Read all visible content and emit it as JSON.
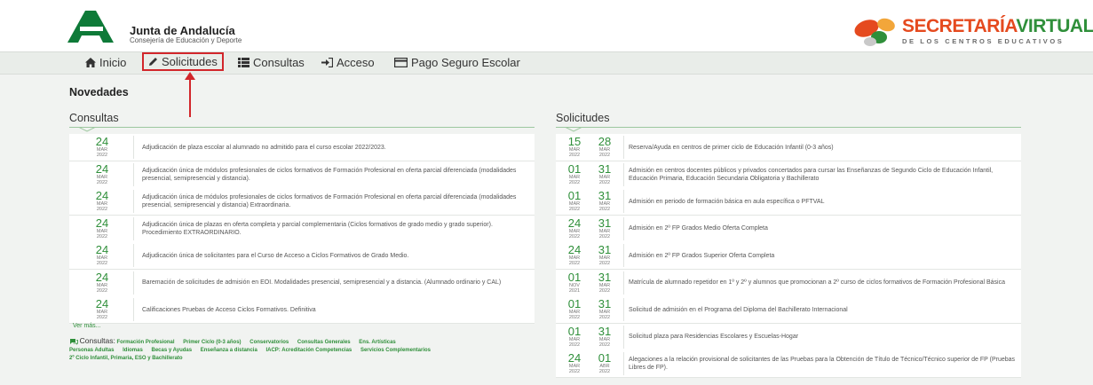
{
  "header": {
    "org_name": "Junta de Andalucía",
    "org_sub": "Consejería de Educación y Deporte",
    "sv_title_a": "SECRETARÍA",
    "sv_title_b": "VIRTUAL",
    "sv_sub": "DE LOS CENTROS EDUCATIVOS"
  },
  "nav": {
    "items": [
      {
        "label": "Inicio",
        "icon": "home-icon"
      },
      {
        "label": "Solicitudes",
        "icon": "pencil-icon"
      },
      {
        "label": "Consultas",
        "icon": "list-icon"
      },
      {
        "label": "Acceso",
        "icon": "sign-in-icon"
      },
      {
        "label": "Pago Seguro Escolar",
        "icon": "credit-card-icon"
      }
    ]
  },
  "novedades_title": "Novedades",
  "consultas": {
    "title": "Consultas",
    "rows": [
      {
        "day": "24",
        "month": "MAR",
        "year": "2022",
        "text": "Adjudicación de plaza escolar al alumnado no admitido para el curso escolar 2022/2023."
      },
      {
        "day": "24",
        "month": "MAR",
        "year": "2022",
        "text": "Adjudicación única de módulos profesionales de ciclos formativos de Formación Profesional en oferta parcial diferenciada (modalidades presencial, semipresencial y distancia)."
      },
      {
        "day": "24",
        "month": "MAR",
        "year": "2022",
        "text": "Adjudicación única de módulos profesionales de ciclos formativos de Formación Profesional en oferta parcial diferenciada (modalidades presencial, semipresencial y distancia) Extraordinaria."
      },
      {
        "day": "24",
        "month": "MAR",
        "year": "2022",
        "text": "Adjudicación única de plazas en oferta completa y parcial complementaria (Ciclos formativos de grado medio y grado superior). Procedimiento EXTRAORDINARIO."
      },
      {
        "day": "24",
        "month": "MAR",
        "year": "2022",
        "text": "Adjudicación única de solicitantes para el Curso de Acceso a Ciclos Formativos de Grado Medio."
      },
      {
        "day": "24",
        "month": "MAR",
        "year": "2022",
        "text": "Baremación de solicitudes de admisión en EOI. Modalidades presencial, semipresencial y a distancia. (Alumnado ordinario y CAL)"
      },
      {
        "day": "24",
        "month": "MAR",
        "year": "2022",
        "text": "Calificaciones Pruebas de Acceso Ciclos Formativos. Definitiva"
      }
    ],
    "ver_mas": "Ver más...",
    "links_lead": "Consultas:",
    "links": [
      "Formación Profesional",
      "Primer Ciclo (0-3 años)",
      "Conservatorios",
      "Consultas Generales",
      "Ens. Artísticas",
      "Personas Adultas",
      "Idiomas",
      "Becas y Ayudas",
      "Enseñanza a distancia",
      "IACP: Acreditación Competencias",
      "Servicios Complementarios",
      "2º Ciclo Infantil, Primaria, ESO y Bachillerato"
    ]
  },
  "solicitudes": {
    "title": "Solicitudes",
    "rows": [
      {
        "d1": "15",
        "m1": "MAR",
        "y1": "2022",
        "d2": "28",
        "m2": "MAR",
        "y2": "2022",
        "text": "Reserva/Ayuda en centros de primer ciclo de Educación Infantil (0-3 años)"
      },
      {
        "d1": "01",
        "m1": "MAR",
        "y1": "2022",
        "d2": "31",
        "m2": "MAR",
        "y2": "2022",
        "text": "Admisión en centros docentes públicos y privados concertados para cursar las Enseñanzas de Segundo Ciclo de Educación Infantil, Educación Primaria, Educación Secundaria Obligatoria y Bachillerato"
      },
      {
        "d1": "01",
        "m1": "MAR",
        "y1": "2022",
        "d2": "31",
        "m2": "MAR",
        "y2": "2022",
        "text": "Admisión en periodo de formación básica en aula específica o PFTVAL"
      },
      {
        "d1": "24",
        "m1": "MAR",
        "y1": "2022",
        "d2": "31",
        "m2": "MAR",
        "y2": "2022",
        "text": "Admisión en 2º FP Grados Medio Oferta Completa"
      },
      {
        "d1": "24",
        "m1": "MAR",
        "y1": "2022",
        "d2": "31",
        "m2": "MAR",
        "y2": "2022",
        "text": "Admisión en 2º FP Grados Superior Oferta Completa"
      },
      {
        "d1": "01",
        "m1": "NOV",
        "y1": "2021",
        "d2": "31",
        "m2": "MAR",
        "y2": "2022",
        "text": "Matrícula de alumnado repetidor en 1º y 2º y alumnos que promocionan a 2º curso de ciclos formativos de Formación Profesional Básica"
      },
      {
        "d1": "01",
        "m1": "MAR",
        "y1": "2022",
        "d2": "31",
        "m2": "MAR",
        "y2": "2022",
        "text": "Solicitud de admisión en el Programa del Diploma del Bachillerato Internacional"
      },
      {
        "d1": "01",
        "m1": "MAR",
        "y1": "2022",
        "d2": "31",
        "m2": "MAR",
        "y2": "2022",
        "text": "Solicitud plaza para Residencias Escolares y Escuelas-Hogar"
      },
      {
        "d1": "24",
        "m1": "MAR",
        "y1": "2022",
        "d2": "01",
        "m2": "ABR",
        "y2": "2022",
        "text": "Alegaciones a la relación provisional de solicitantes de las Pruebas para la Obtención de Título de Técnico/Técnico superior de FP (Pruebas Libres de FP)."
      }
    ]
  },
  "colors": {
    "accent": "#2f8f3a",
    "highlight": "#d2262b",
    "brand_orange": "#e54a1f"
  }
}
